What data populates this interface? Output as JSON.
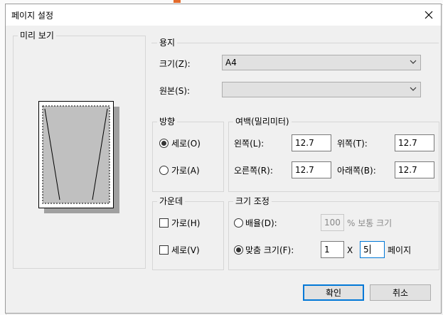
{
  "dialog": {
    "title": "페이지 설정",
    "close_icon": "close-icon"
  },
  "preview": {
    "label": "미리 보기"
  },
  "paper": {
    "label": "용지",
    "size_label": "크기(Z):",
    "size_value": "A4",
    "source_label": "원본(S):",
    "source_value": ""
  },
  "orientation": {
    "label": "방향",
    "portrait_label": "세로(O)",
    "landscape_label": "가로(A)",
    "selected": "portrait"
  },
  "margins": {
    "label": "여백(밀리미터)",
    "left_label": "왼쪽(L):",
    "left_value": "12.7",
    "top_label": "위쪽(T):",
    "top_value": "12.7",
    "right_label": "오른쪽(R):",
    "right_value": "12.7",
    "bottom_label": "아래쪽(B):",
    "bottom_value": "12.7"
  },
  "center": {
    "label": "가운데",
    "horizontal_label": "가로(H)",
    "vertical_label": "세로(V)"
  },
  "scaling": {
    "label": "크기 조정",
    "adjust_label": "배율(D):",
    "adjust_value": "100",
    "adjust_suffix": "% 보통 크기",
    "fit_label": "맞춤 크기(F):",
    "fit_wide_value": "1",
    "x_label": "X",
    "fit_tall_value": "5",
    "pages_label": "페이지",
    "selected": "fit"
  },
  "buttons": {
    "ok_label": "확인",
    "cancel_label": "취소"
  },
  "colors": {
    "accent": "#0078d7",
    "dialog_bg": "#f0f0f0",
    "paper_shadow": "#a0a0a0",
    "printable_area": "#c0c0c0"
  }
}
